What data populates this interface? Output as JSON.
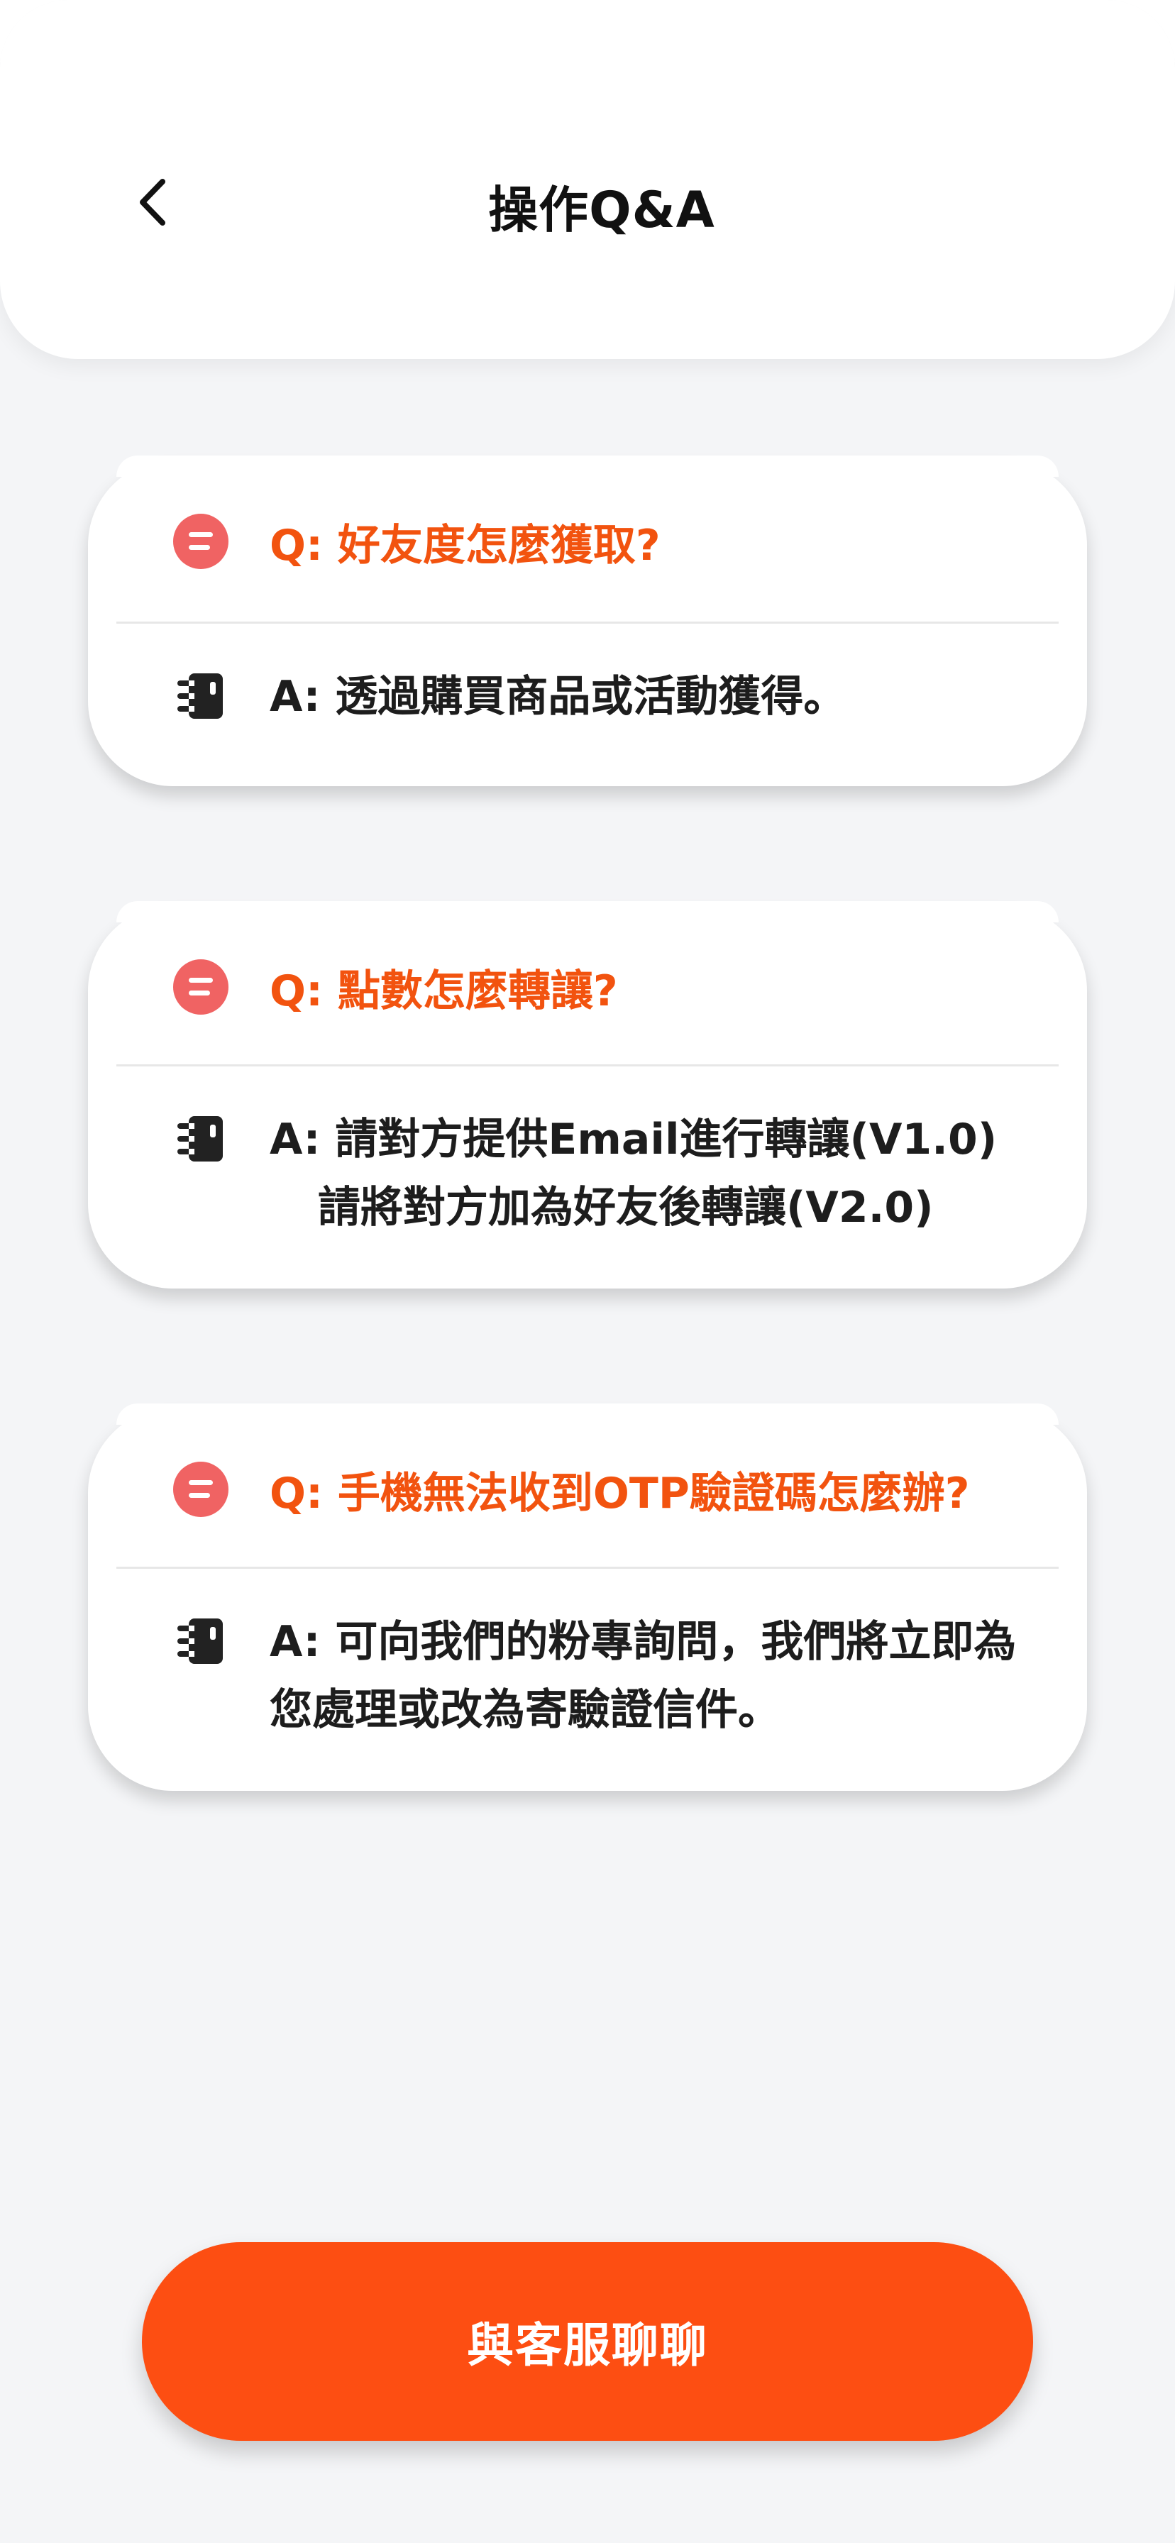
{
  "header": {
    "title": "操作Q&A",
    "back_icon": "chevron-left-icon"
  },
  "faq": [
    {
      "question": "Q: 好友度怎麼獲取?",
      "answer_lines": [
        "A: 透過購買商品或活動獲得。"
      ]
    },
    {
      "question": "Q: 點數怎麼轉讓?",
      "answer_lines": [
        "A: 請對方提供Email進行轉讓(V1.0)",
        "請將對方加為好友後轉讓(V2.0)"
      ]
    },
    {
      "question": "Q: 手機無法收到OTP驗證碼怎麼辦?",
      "answer_lines": [
        "A: 可向我們的粉專詢問，我們將立即為",
        "您處理或改為寄驗證信件。"
      ]
    }
  ],
  "icons": {
    "question_icon": "chat-bubble-icon",
    "answer_icon": "notebook-icon"
  },
  "colors": {
    "accent": "#fd4e12",
    "question_text": "#f2530f",
    "question_icon": "#f06363",
    "background": "#f4f5f7"
  },
  "cta": {
    "label": "與客服聊聊"
  }
}
